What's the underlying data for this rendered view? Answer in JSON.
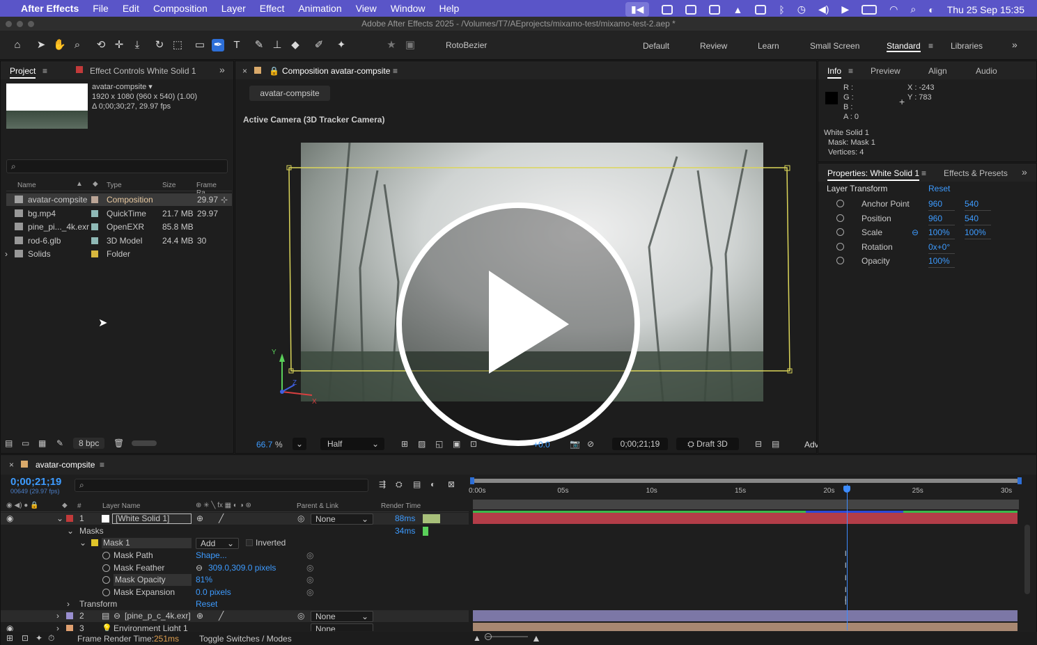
{
  "menubar": {
    "app": "After Effects",
    "items": [
      "File",
      "Edit",
      "Composition",
      "Layer",
      "Effect",
      "Animation",
      "View",
      "Window",
      "Help"
    ],
    "datetime": "Thu 25 Sep  15:35"
  },
  "window_title": "Adobe After Effects 2025 - /Volumes/T7/AEprojects/mixamo-test/mixamo-test-2.aep *",
  "toolbar": {
    "rotobezier_label": "RotoBezier",
    "workspaces": [
      "Default",
      "Review",
      "Learn",
      "Small Screen",
      "Standard",
      "Libraries"
    ],
    "active_workspace": "Standard"
  },
  "project": {
    "tab_project": "Project",
    "tab_effect_controls": "Effect Controls White Solid 1",
    "comp_name": "avatar-compsite ▾",
    "comp_res": "1920 x 1080  (960 x 540) (1.00)",
    "comp_dur": "Δ 0;00;30;27, 29.97 fps",
    "search_placeholder": "",
    "columns": {
      "name": "Name",
      "type": "Type",
      "size": "Size",
      "fps": "Frame Ra..."
    },
    "items": [
      {
        "name": "avatar-compsite",
        "type": "Composition",
        "size": "",
        "fps": "29.97",
        "color": "#bba596"
      },
      {
        "name": "bg.mp4",
        "type": "QuickTime",
        "size": "21.7 MB",
        "fps": "29.97",
        "color": "#8fb9b6"
      },
      {
        "name": "pine_pi..._4k.exr",
        "type": "OpenEXR",
        "size": "85.8 MB",
        "fps": "",
        "color": "#8fb9b6"
      },
      {
        "name": "rod-6.glb",
        "type": "3D Model",
        "size": "24.4 MB",
        "fps": "30",
        "color": "#8fb9b6"
      },
      {
        "name": "Solids",
        "type": "Folder",
        "size": "",
        "fps": "",
        "color": "#d8b73e"
      }
    ],
    "bpc": "8 bpc"
  },
  "comp": {
    "tab": "Composition avatar-compsite",
    "breadcrumb": "avatar-compsite",
    "camera_label": "Active Camera (3D Tracker Camera)",
    "zoom": "66.7",
    "zoom_unit": "%",
    "resolution": "Half",
    "exposure": "+0.0",
    "timecode": "0;00;21;19",
    "renderer": "Draft 3D",
    "adv": "Adv"
  },
  "info": {
    "tabs": [
      "Info",
      "Preview",
      "Align",
      "Audio"
    ],
    "r": "R :",
    "g": "G :",
    "b": "B :",
    "a": "A :  0",
    "x": "X : -243",
    "y": "Y : 783",
    "layer": "White Solid 1",
    "mask": "Mask: Mask 1",
    "vertices": "Vertices: 4"
  },
  "properties": {
    "tab": "Properties: White Solid 1",
    "tab2": "Effects & Presets",
    "section": "Layer Transform",
    "reset": "Reset",
    "rows": [
      {
        "label": "Anchor Point",
        "v1": "960",
        "v2": "540"
      },
      {
        "label": "Position",
        "v1": "960",
        "v2": "540"
      },
      {
        "label": "Scale",
        "v1": "100%",
        "v2": "100%"
      },
      {
        "label": "Rotation",
        "v1": "0x+0°",
        "v2": ""
      },
      {
        "label": "Opacity",
        "v1": "100%",
        "v2": ""
      }
    ]
  },
  "timeline": {
    "tab": "avatar-compsite",
    "timecode": "0;00;21;19",
    "frame_info": "00649 (29.97 fps)",
    "col_layer_name": "Layer Name",
    "col_parent": "Parent & Link",
    "col_render": "Render Time",
    "ruler": [
      "0:00s",
      "05s",
      "10s",
      "15s",
      "20s",
      "25s",
      "30s"
    ],
    "playhead_fraction": 0.7,
    "layers": [
      {
        "num": "1",
        "name": "[White Solid 1]",
        "parent": "None",
        "render": "88ms",
        "color": "#c23a3a"
      },
      {
        "num": "2",
        "name": "[pine_p_c_4k.exr]",
        "parent": "None",
        "render": "",
        "color": "#9a8fd0"
      },
      {
        "num": "3",
        "name": "Environment Light 1",
        "parent": "None",
        "render": "",
        "color": "#e0a070"
      }
    ],
    "masks_label": "Masks",
    "masks_render": "34ms",
    "mask1": "Mask 1",
    "mask_mode": "Add",
    "inverted": "Inverted",
    "mask_props": [
      {
        "label": "Mask Path",
        "value": "Shape..."
      },
      {
        "label": "Mask Feather",
        "value": "309.0,309.0 pixels"
      },
      {
        "label": "Mask Opacity",
        "value": "81%"
      },
      {
        "label": "Mask Expansion",
        "value": "0.0 pixels"
      }
    ],
    "transform_label": "Transform",
    "transform_reset": "Reset",
    "frame_render_label": "Frame Render Time:",
    "frame_render_value": "251ms",
    "toggle_label": "Toggle Switches / Modes"
  }
}
